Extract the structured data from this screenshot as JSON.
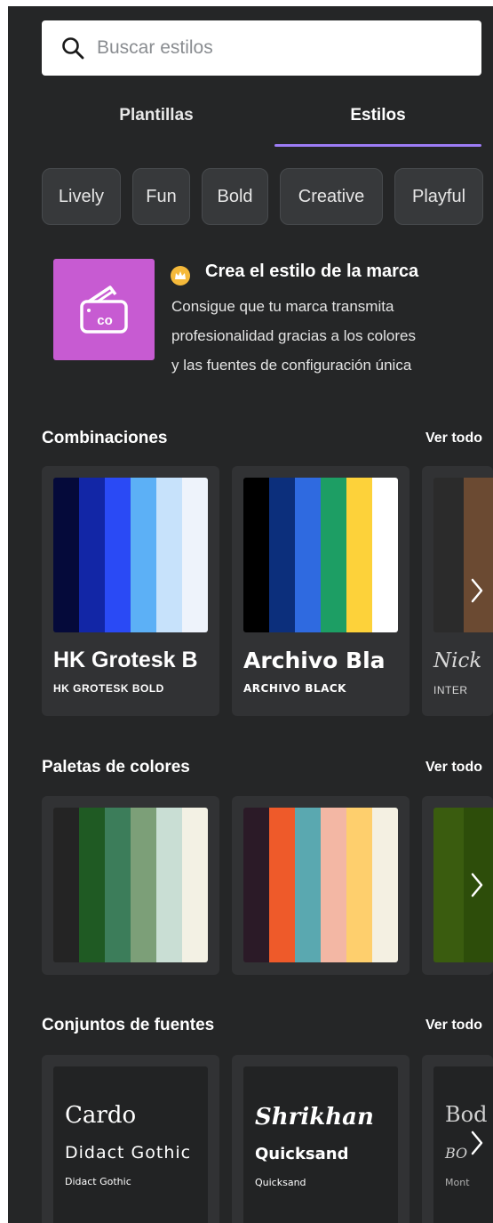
{
  "search": {
    "placeholder": "Buscar estilos"
  },
  "tabs": [
    {
      "label": "Plantillas",
      "active": false
    },
    {
      "label": "Estilos",
      "active": true
    }
  ],
  "chips": [
    "Lively",
    "Fun",
    "Bold",
    "Creative",
    "Playful"
  ],
  "promo": {
    "title": "Crea el estilo de la marca",
    "description_lines": [
      "Consigue que tu marca transmita",
      "profesionalidad gracias a los colores",
      "y las fuentes de configuración única"
    ],
    "image_text": "co",
    "image_color": "#c75bd2",
    "crown_color": "#f5b93a",
    "icon": "brand-kit-icon"
  },
  "combinations": {
    "title": "Combinaciones",
    "see_all": "Ver todo",
    "cards": [
      {
        "colors": [
          "#050a3a",
          "#1226a6",
          "#2a4af5",
          "#5cb0f6",
          "#c7e2fb",
          "#eef3fb"
        ],
        "heading": "HK Grotesk B",
        "subheading": "HK GROTESK BOLD"
      },
      {
        "colors": [
          "#000000",
          "#0c2f7c",
          "#2f6ae0",
          "#1d9e64",
          "#fdd23a",
          "#ffffff"
        ],
        "heading": "Archivo Bla",
        "subheading": "ARCHIVO BLACK"
      },
      {
        "colors": [
          "#2b2b2b",
          "#6b4a32"
        ],
        "heading": "Nick",
        "subheading": "INTER"
      }
    ]
  },
  "palettes": {
    "title": "Paletas de colores",
    "see_all": "Ver todo",
    "cards": [
      {
        "colors": [
          "#242424",
          "#1f5a23",
          "#3c7d5a",
          "#7c9f78",
          "#c9ded4",
          "#f3f1e4"
        ]
      },
      {
        "colors": [
          "#2b1a27",
          "#ee5a2a",
          "#5aa8b0",
          "#f3b7a4",
          "#fecf6d",
          "#f4f0e2"
        ]
      },
      {
        "colors": [
          "#3a5c0f",
          "#2d4d0a"
        ]
      }
    ]
  },
  "font_sets": {
    "title": "Conjuntos de fuentes",
    "see_all": "Ver todo",
    "cards": [
      {
        "heading": "Cardo",
        "subheading": "Didact Gothic",
        "body": "Didact Gothic"
      },
      {
        "heading": "Shrikhan",
        "subheading": "Quicksand",
        "body": "Quicksand"
      },
      {
        "heading": "Bod",
        "subheading": "BO",
        "body": "Mont"
      }
    ]
  },
  "icons": {
    "search": "search-icon",
    "chevron": "chevron-right-icon"
  },
  "colors": {
    "panel_bg": "#252627",
    "accent": "#9d7cf5",
    "card_bg": "#313234"
  }
}
